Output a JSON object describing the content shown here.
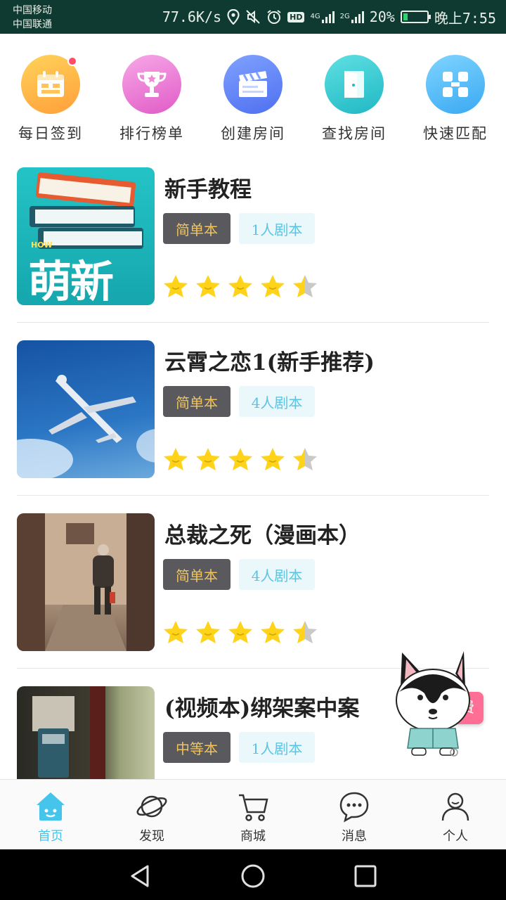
{
  "status_bar": {
    "carrier_1": "中国移动",
    "carrier_2": "中国联通",
    "net_speed": "77.6K/s",
    "hd_badge": "HD",
    "sig1_label": "4G",
    "sig2_label": "2G",
    "battery": "20%",
    "battery_level": 0.2,
    "time": "晚上7:55"
  },
  "quick_menu": [
    {
      "label": "每日签到",
      "icon": "calendar-icon",
      "color_from": "#ffd35a",
      "color_to": "#ff9f3a",
      "has_badge": true
    },
    {
      "label": "排行榜单",
      "icon": "trophy-icon",
      "color_from": "#f7a8e8",
      "color_to": "#e15bc6"
    },
    {
      "label": "创建房间",
      "icon": "clapperboard-icon",
      "color_from": "#7fa2ff",
      "color_to": "#4f6ff0"
    },
    {
      "label": "查找房间",
      "icon": "door-icon",
      "color_from": "#5fe0e3",
      "color_to": "#1fb8c4"
    },
    {
      "label": "快速匹配",
      "icon": "grid-icon",
      "color_from": "#7fd4ff",
      "color_to": "#3aa9f2"
    }
  ],
  "cards": [
    {
      "title": "新手教程",
      "level": "简单本",
      "cast": "1人剧本",
      "rating": 4.5,
      "thumb": "books",
      "thumb_text_small": "HOW",
      "thumb_text_big": "萌新"
    },
    {
      "title": "云霄之恋1(新手推荐)",
      "level": "简单本",
      "cast": "4人剧本",
      "rating": 4.5,
      "thumb": "plane"
    },
    {
      "title": "总裁之死（漫画本）",
      "level": "简单本",
      "cast": "4人剧本",
      "rating": 4.5,
      "thumb": "alley"
    },
    {
      "title": "(视频本)绑架案中案",
      "level": "中等本",
      "cast": "1人剧本",
      "rating": 4.5,
      "thumb": "payphone"
    }
  ],
  "mascot": {
    "badge": "费"
  },
  "bottom_nav": [
    {
      "label": "首页",
      "icon": "home-icon",
      "active": true
    },
    {
      "label": "发现",
      "icon": "planet-icon"
    },
    {
      "label": "商城",
      "icon": "cart-icon"
    },
    {
      "label": "消息",
      "icon": "chat-icon"
    },
    {
      "label": "个人",
      "icon": "user-icon"
    }
  ],
  "colors": {
    "accent": "#45c4ec",
    "star": "#ffd31a",
    "star_empty": "#c9c9c9",
    "tag_level_bg": "#5a5a5e",
    "tag_level_fg": "#f1c45a",
    "tag_cast_bg": "#eaf7fb",
    "tag_cast_fg": "#5bc4e3"
  }
}
